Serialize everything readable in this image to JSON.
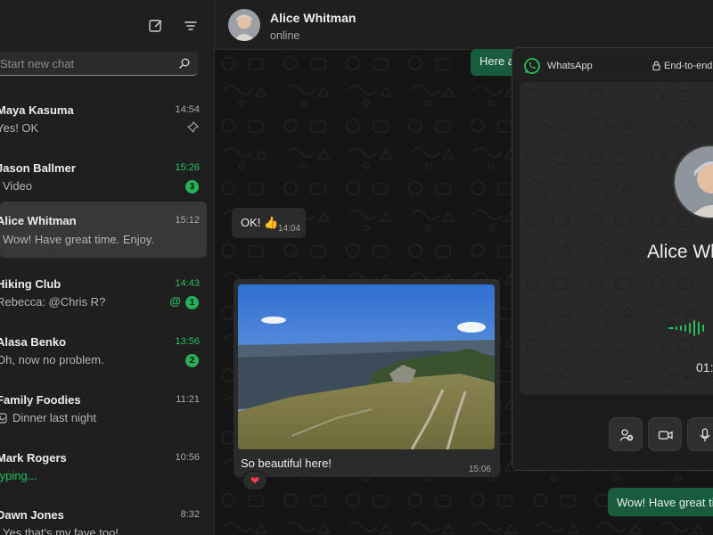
{
  "sidebar": {
    "search_placeholder": "Start new chat",
    "chats": [
      {
        "name": "Maya Kasuma",
        "time": "14:54",
        "preview": "Yes! OK",
        "pinned": true
      },
      {
        "name": "Jason Ballmer",
        "time": "15:26",
        "time_color": "green",
        "preview": "Video",
        "preview_icon": "video-icon",
        "unread": "3"
      },
      {
        "name": "Alice Whitman",
        "time": "15:12",
        "preview": "Wow! Have great time. Enjoy.",
        "preview_icon": "double-check-icon",
        "active": true
      },
      {
        "name": "Hiking Club",
        "time": "14:43",
        "time_color": "green",
        "preview": "Rebecca: @Chris R?",
        "mention": "@",
        "unread": "1"
      },
      {
        "name": "Alasa Benko",
        "time": "13:56",
        "time_color": "green",
        "preview": "Oh, now no problem.",
        "unread": "2"
      },
      {
        "name": "Family Foodies",
        "time": "11:21",
        "preview": "Dinner last night",
        "preview_icon": "image-icon"
      },
      {
        "name": "Mark Rogers",
        "time": "10:56",
        "preview": "typing...",
        "preview_color": "green"
      },
      {
        "name": "Dawn Jones",
        "time": "8:32",
        "preview": "Yes that's my fave too!",
        "preview_icon": "double-check-icon"
      }
    ]
  },
  "chat": {
    "contact_name": "Alice Whitman",
    "contact_status": "online",
    "messages": {
      "out_top": "Here a",
      "in_ok": "OK! 👍",
      "in_ok_time": "14:04",
      "photo_caption": "So beautiful here!",
      "photo_time": "15:06",
      "reaction": "❤",
      "out_bottom": "Wow! Have great tim"
    }
  },
  "call": {
    "app_name": "WhatsApp",
    "encryption": "End-to-end",
    "contact_name": "Alice Wh",
    "duration": "01:"
  },
  "colors": {
    "accent_green": "#25c05e",
    "outgoing_bubble": "#175c3c",
    "incoming_bubble": "#2b2b2b"
  }
}
